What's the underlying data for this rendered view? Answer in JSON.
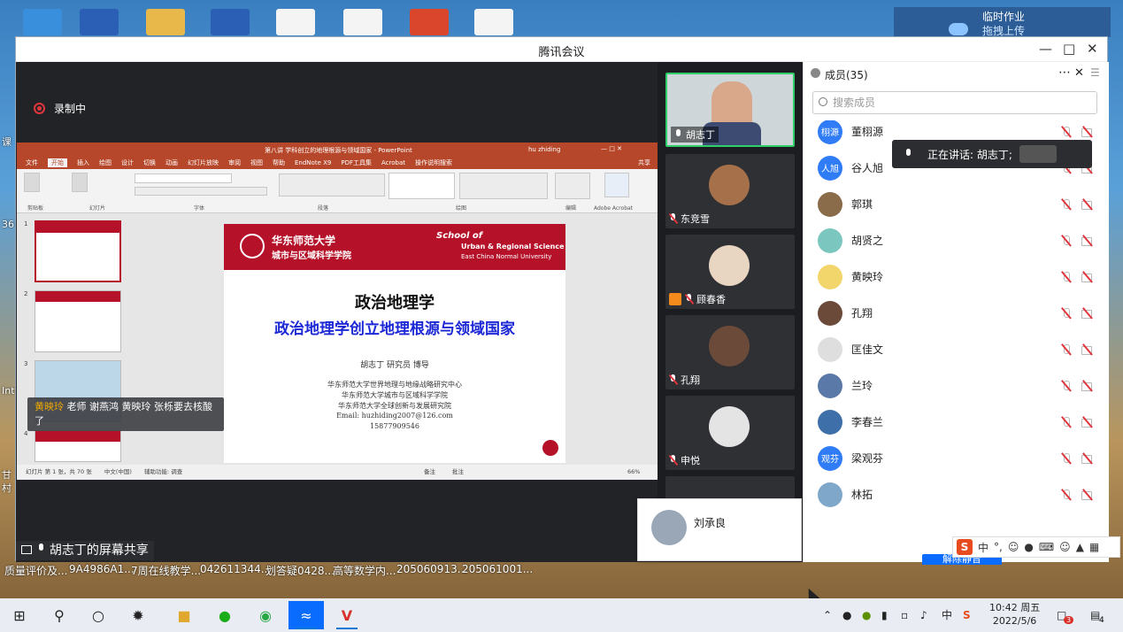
{
  "window": {
    "title": "腾讯会议"
  },
  "recording": {
    "label": "录制中"
  },
  "desktop": {
    "panel_title": "临时作业",
    "panel_btn": "拖拽上传",
    "files": [
      "质量评价及...",
      "9A4986A1...",
      "7周在线教学...",
      "042611344...",
      "划答疑0428...",
      "高等数学内...",
      "205060913...",
      "205061001..."
    ],
    "edge_labels": [
      "课",
      "36",
      "Int",
      "甘",
      "村"
    ]
  },
  "ppt": {
    "title": "第八讲 学科创立的地理根源与领域国家 - PowerPoint",
    "user": "hu zhiding",
    "tabs": [
      "文件",
      "开始",
      "插入",
      "绘图",
      "设计",
      "切换",
      "动画",
      "幻灯片放映",
      "审阅",
      "视图",
      "帮助",
      "EndNote X9",
      "PDF工具集",
      "Acrobat",
      "操作说明搜索"
    ],
    "share_btn": "共享",
    "ribbon_groups": [
      "剪贴板",
      "幻灯片",
      "字体",
      "段落",
      "绘图",
      "编辑",
      "Adobe Acrobat"
    ],
    "thumb_numbers": [
      "1",
      "2",
      "3",
      "4"
    ],
    "slide": {
      "school_cn": "华东师范大学",
      "school_cn2": "城市与区域科学学院",
      "school_en1": "School of",
      "school_en2": "Urban & Regional Science",
      "school_en3": "East China Normal University",
      "title1": "政治地理学",
      "title2": "政治地理学创立地理根源与领域国家",
      "authors": "胡志丁  研究员  博导",
      "aff1": "华东师范大学世界地理与地缘战略研究中心",
      "aff2": "华东师范大学城市与区域科学学院",
      "aff3": "华东师范大学全球创新与发展研究院",
      "email": "Email: huzhiding2007@126.com",
      "phone": "15877909546"
    },
    "status_left": "幻灯片 第 1 张，共 70 张",
    "status_lang": "中文(中国)",
    "status_access": "辅助功能: 调查",
    "status_notes": "备注",
    "status_comments": "批注",
    "zoom": "66%"
  },
  "chat_toast": {
    "sender": "黄映玲",
    "text": "老师 谢燕鸿 黄映玲 张栎要去核酸了"
  },
  "share_label": "胡志丁的屏幕共享",
  "videos": [
    {
      "name": "胡志丁",
      "mic": "on"
    },
    {
      "name": "东竞雪",
      "mic": "off"
    },
    {
      "name": "顾春香",
      "mic": "off"
    },
    {
      "name": "孔翔",
      "mic": "off"
    },
    {
      "name": "申悦",
      "mic": "off"
    }
  ],
  "members": {
    "title": "成员(35)",
    "search_placeholder": "搜索成员",
    "list": [
      {
        "name": "董栩源",
        "avatar_text": "栩源",
        "color": "#2f7cf6"
      },
      {
        "name": "谷人旭",
        "avatar_text": "人旭",
        "color": "#2f7cf6"
      },
      {
        "name": "郭琪",
        "avatar_text": "",
        "color": "#8a6b4a"
      },
      {
        "name": "胡贤之",
        "avatar_text": "",
        "color": "#7cc6c0"
      },
      {
        "name": "黄映玲",
        "avatar_text": "",
        "color": "#f2d56b"
      },
      {
        "name": "孔翔",
        "avatar_text": "",
        "color": "#6b4a3a"
      },
      {
        "name": "匡佳文",
        "avatar_text": "",
        "color": "#dedede"
      },
      {
        "name": "兰玲",
        "avatar_text": "",
        "color": "#5a78a8"
      },
      {
        "name": "李春兰",
        "avatar_text": "",
        "color": "#3f6fa8"
      },
      {
        "name": "梁观芬",
        "avatar_text": "观芬",
        "color": "#2f7cf6"
      },
      {
        "name": "林拓",
        "avatar_text": "",
        "color": "#7fa7c9"
      }
    ],
    "unmute_btn": "解除静音"
  },
  "speaking": {
    "text": "正在讲话: 胡志丁;"
  },
  "popup_user": {
    "name": "刘承良"
  },
  "ime": {
    "lang": "中"
  },
  "taskbar": {
    "tray_lang": "中",
    "time": "10:42 周五",
    "date": "2022/5/6",
    "notif_badge": "3",
    "msg_badge": "4"
  }
}
